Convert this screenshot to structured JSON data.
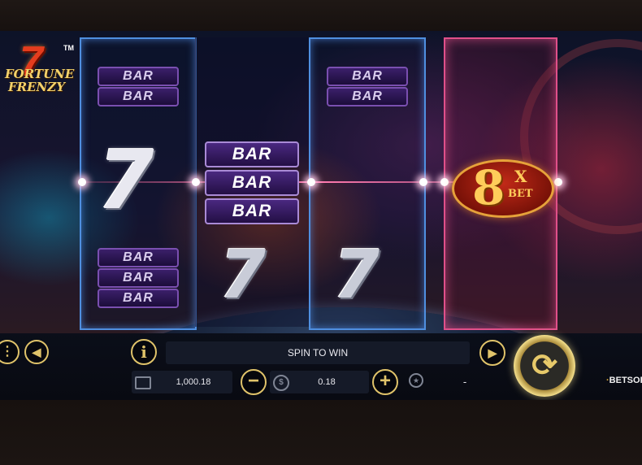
{
  "game": {
    "logo_number": "7",
    "logo_line1": "FORTUNE",
    "logo_line2": "FRENZY",
    "logo_tm": "TM"
  },
  "reels": {
    "reel1": {
      "top": [
        "BAR",
        "BAR"
      ],
      "middle": "7",
      "bottom": [
        "BAR",
        "BAR",
        "BAR"
      ]
    },
    "reel2": {
      "middle": [
        "BAR",
        "BAR",
        "BAR"
      ],
      "bottom": "7"
    },
    "reel3": {
      "top": [
        "BAR",
        "BAR"
      ],
      "bottom": "7"
    },
    "reel4": {
      "multiplier": "8",
      "x": "X",
      "bet": "BET"
    }
  },
  "hud": {
    "message": "SPIN TO WIN",
    "balance": "1,000.18",
    "bet": "0.18",
    "win": "-",
    "info_icon": "i",
    "menu_icon": "⋮",
    "sound_icon": "◀",
    "autoplay_icon": "▶",
    "minus_icon": "−",
    "plus_icon": "+",
    "spin_icon": "⟳",
    "coin_icon": "$",
    "brand_a": "BET",
    "brand_b": "SOFT",
    "brand_dot": "·"
  },
  "icons": [
    "menu-icon",
    "sound-icon",
    "info-icon",
    "autoplay-icon",
    "wallet-icon",
    "minus-icon",
    "coin-icon",
    "plus-icon",
    "medal-icon",
    "spin-icon"
  ],
  "colors": {
    "accent_gold": "#e0c36a",
    "reel_blue": "#4f8fe0",
    "reel_pink": "#e0508a",
    "bar_purple": "#3b1f6a"
  }
}
